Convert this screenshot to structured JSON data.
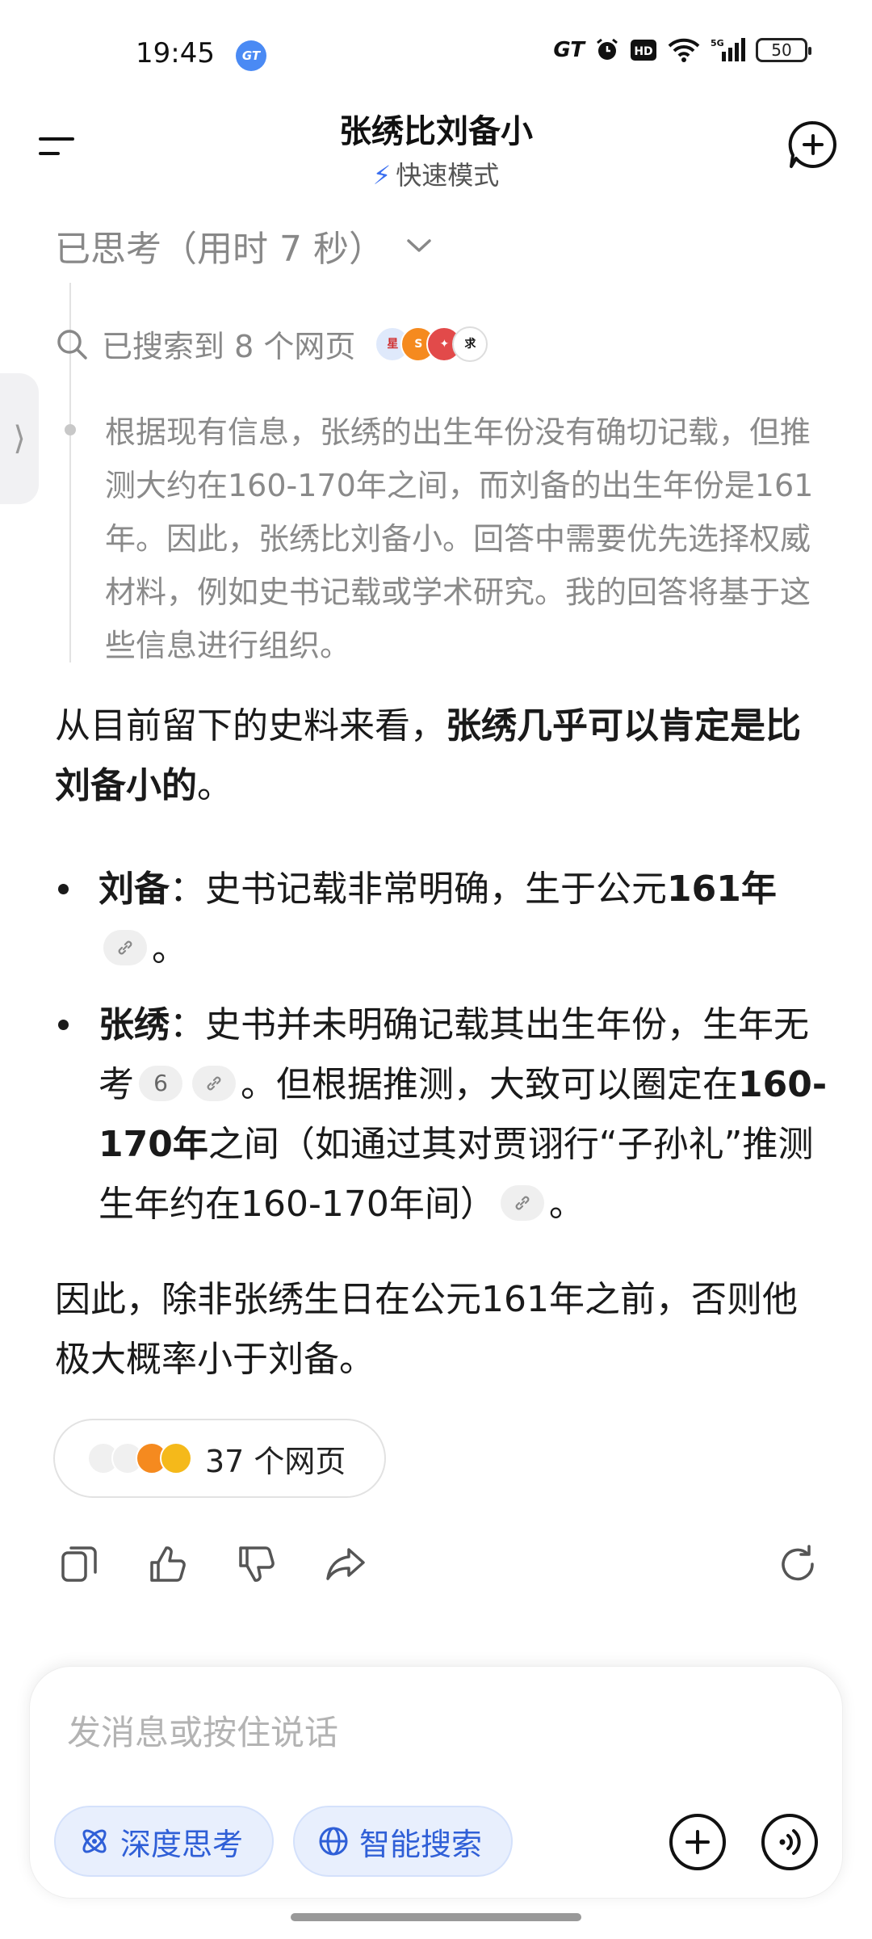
{
  "status": {
    "time": "19:45",
    "network": "5G",
    "battery": "50",
    "gt_label": "GT"
  },
  "header": {
    "title": "张绣比刘备小",
    "mode": "快速模式"
  },
  "thinking": {
    "summary": "已思考（用时 7 秒）",
    "searched": "已搜索到 8 个网页",
    "text": "根据现有信息，张绣的出生年份没有确切记载，但推测大约在160-170年之间，而刘备的出生年份是161年。因此，张绣比刘备小。回答中需要优先选择权威材料，例如史书记载或学术研究。我的回答将基于这些信息进行组织。"
  },
  "answer": {
    "intro_plain": "从目前留下的史料来看，",
    "intro_bold": "张绣几乎可以肯定是比刘备小的",
    "intro_end": "。",
    "bullet1_name": "刘备",
    "bullet1_text": "：史书记载非常明确，生于公元",
    "bullet1_bold": "161年",
    "bullet1_end": "。",
    "bullet2_name": "张绣",
    "bullet2_text": "：史书并未明确记载其出生年份，生年无考",
    "bullet2_ref": "6",
    "bullet2_text2": "。但根据推测，大致可以圈定在",
    "bullet2_bold": "160-170年",
    "bullet2_text3": "之间（如通过其对贾诩行“子孙礼”推测生年约在160-170年间）",
    "bullet2_end": "。",
    "conclusion": "因此，除非张绣生日在公元161年之前，否则他极大概率小于刘备。",
    "sources": "37 个网页"
  },
  "input": {
    "placeholder": "发消息或按住说话",
    "deep_think": "深度思考",
    "smart_search": "智能搜索"
  },
  "colors": {
    "accent": "#3a6ff0",
    "chip_bg": "#e8effd",
    "muted_text": "#8a8a8a"
  }
}
